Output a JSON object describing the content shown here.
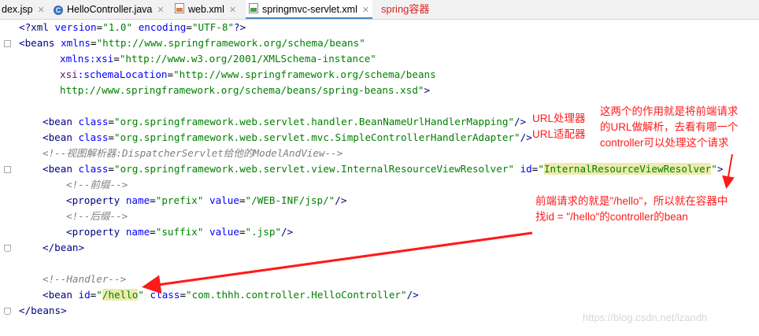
{
  "tabs": [
    {
      "label": "dex.jsp",
      "icon": "jsp-file-icon"
    },
    {
      "label": "HelloController.java",
      "icon": "java-class-icon"
    },
    {
      "label": "web.xml",
      "icon": "xml-file-icon"
    },
    {
      "label": "springmvc-servlet.xml",
      "icon": "xml-file-icon",
      "active": true
    }
  ],
  "tab_annotation": "spring容器",
  "code": {
    "l1": {
      "a": "<?",
      "b": "xml ",
      "c": "version",
      "d": "=",
      "e": "\"1.0\"",
      "f": " encoding",
      "g": "=",
      "h": "\"UTF-8\"",
      "i": "?>"
    },
    "l2": {
      "a": "<beans ",
      "b": "xmlns",
      "c": "=",
      "d": "\"http://www.springframework.org/schema/beans\""
    },
    "l3": {
      "a": "xmlns:xsi",
      "b": "=",
      "c": "\"http://www.w3.org/2001/XMLSchema-instance\""
    },
    "l4": {
      "a": "xsi",
      "b": ":schemaLocation",
      "c": "=",
      "d": "\"http://www.springframework.org/schema/beans"
    },
    "l5": {
      "a": "http://www.springframework.org/schema/beans/spring-beans.xsd\"",
      "b": ">"
    },
    "l6": {
      "a": "<bean ",
      "b": "class",
      "c": "=",
      "d": "\"org.springframework.web.servlet.handler.BeanNameUrlHandlerMapping\"",
      "e": "/>"
    },
    "l7": {
      "a": "<bean ",
      "b": "class",
      "c": "=",
      "d": "\"org.springframework.web.servlet.mvc.SimpleControllerHandlerAdapter\"",
      "e": "/>"
    },
    "l8": "<!--视图解析器:DispatcherServlet给他的ModelAndView-->",
    "l9": {
      "a": "<bean ",
      "b": "class",
      "c": "=",
      "d": "\"org.springframework.web.servlet.view.InternalResourceViewResolver\"",
      "e": " id",
      "f": "=",
      "g": "\"",
      "h": "InternalResourceViewResolver",
      "i": "\"",
      "j": ">"
    },
    "l10": "<!--前缀-->",
    "l11": {
      "a": "<property ",
      "b": "name",
      "c": "=",
      "d": "\"prefix\"",
      "e": " value",
      "f": "=",
      "g": "\"/WEB-INF/jsp/\"",
      "h": "/>"
    },
    "l12": "<!--后缀-->",
    "l13": {
      "a": "<property ",
      "b": "name",
      "c": "=",
      "d": "\"suffix\"",
      "e": " value",
      "f": "=",
      "g": "\".jsp\"",
      "h": "/>"
    },
    "l14": "</bean>",
    "l15": "<!--Handler-->",
    "l16": {
      "a": "<bean ",
      "b": "id",
      "c": "=",
      "d": "\"",
      "e": "/hello",
      "f": "\"",
      "g": " class",
      "h": "=",
      "i": "\"com.thhh.controller.HelloController\"",
      "j": "/>"
    },
    "l17": "</beans>"
  },
  "annotations": {
    "url_handler": "URL处理器",
    "url_adapter": "URL适配器",
    "explain": [
      "这两个的作用就是将前端请求",
      "的URL做解析，去看有哪一个",
      "controller可以处理这个请求"
    ],
    "hello_note": [
      "前端请求的就是\"/hello\"，所以就在容器中",
      "找id = \"/hello\"的controller的bean"
    ]
  },
  "colors": {
    "annotation": "#ff1a1a",
    "tag": "#000080",
    "attribute": "#0000ff",
    "value": "#008000",
    "comment": "#808080",
    "highlight": "#edebad"
  },
  "watermark": "https://blog.csdn.net/lzandh"
}
